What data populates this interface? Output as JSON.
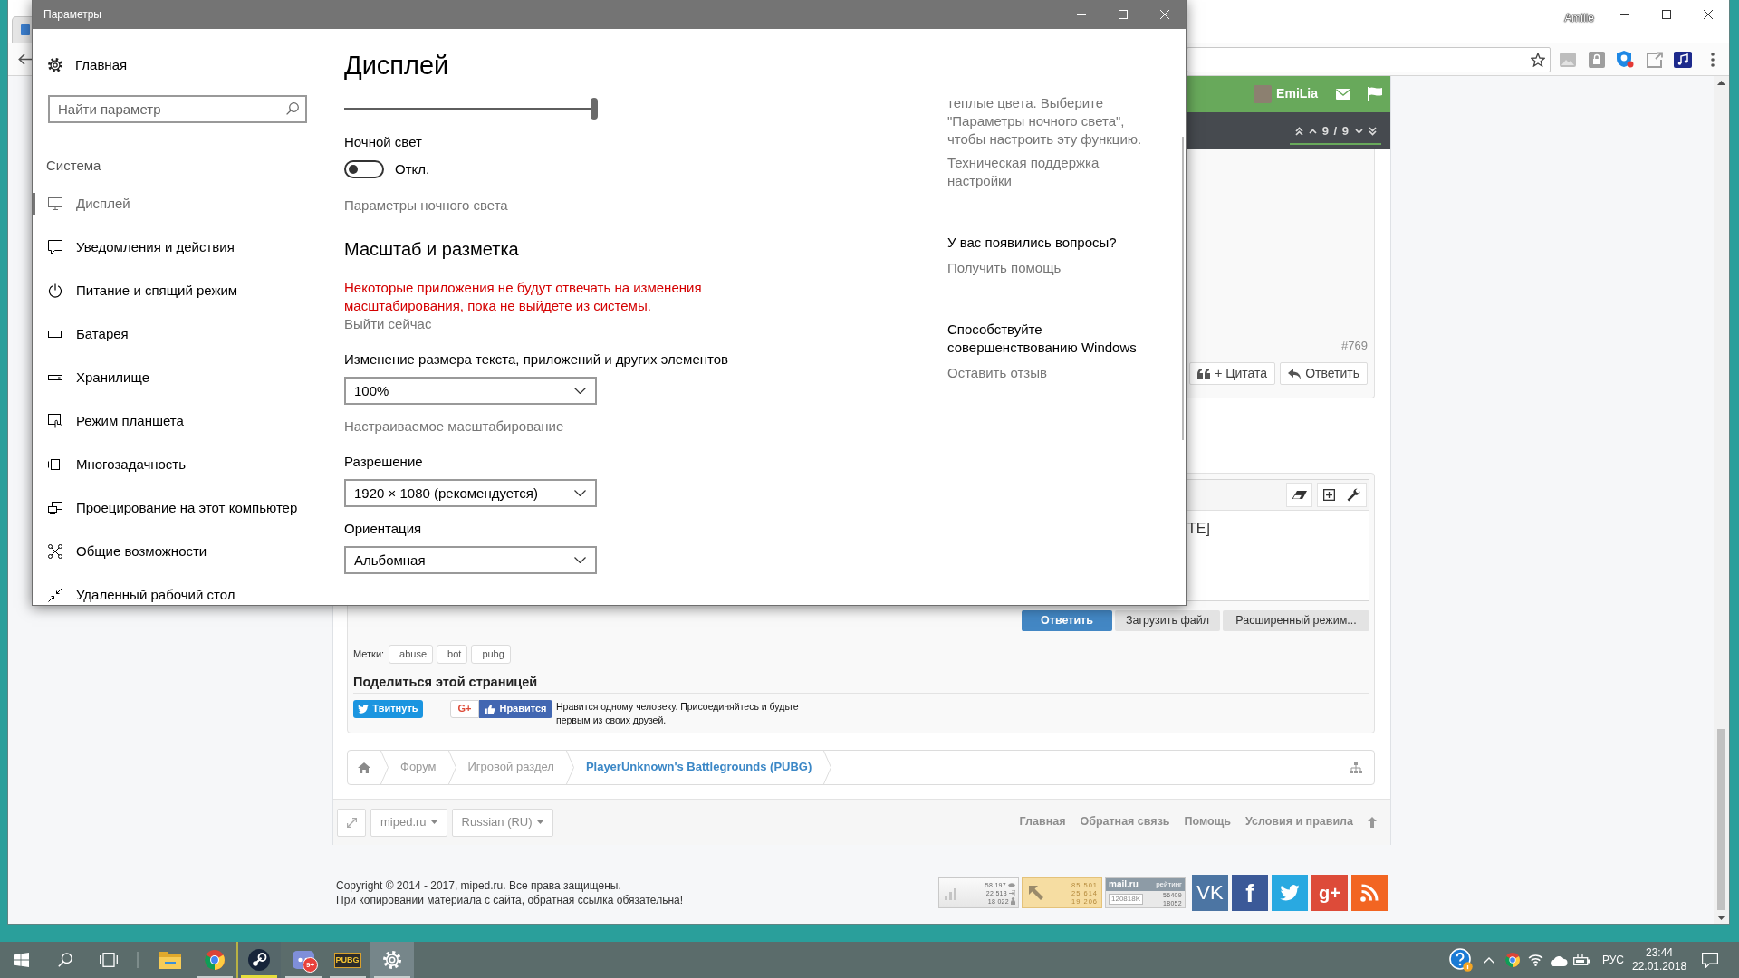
{
  "settings": {
    "title": "Параметры",
    "home": "Главная",
    "search": {
      "placeholder": "Найти параметр"
    },
    "section": "Система",
    "nav": [
      {
        "kind": "display",
        "label": "Дисплей",
        "selected": true
      },
      {
        "kind": "notifications",
        "label": "Уведомления и действия",
        "selected": false
      },
      {
        "kind": "power",
        "label": "Питание и спящий режим",
        "selected": false
      },
      {
        "kind": "battery",
        "label": "Батарея",
        "selected": false
      },
      {
        "kind": "storage",
        "label": "Хранилище",
        "selected": false
      },
      {
        "kind": "tablet",
        "label": "Режим планшета",
        "selected": false
      },
      {
        "kind": "multitasking",
        "label": "Многозадачность",
        "selected": false
      },
      {
        "kind": "projecting",
        "label": "Проецирование на этот компьютер",
        "selected": false
      },
      {
        "kind": "accessibility",
        "label": "Общие возможности",
        "selected": false
      },
      {
        "kind": "remote",
        "label": "Удаленный рабочий стол",
        "selected": false
      }
    ],
    "page_title": "Дисплей",
    "brightness": {
      "level": 1
    },
    "night_light": {
      "label": "Ночной свет",
      "on": false,
      "state": "Откл.",
      "link": "Параметры ночного света"
    },
    "scale": {
      "heading": "Масштаб и разметка",
      "warning": "Некоторые приложения не будут отвечать на изменения масштабирования, пока не выйдете из системы.",
      "action": "Выйти сейчас",
      "fields": [
        {
          "label": "Изменение размера текста, приложений и других элементов",
          "value": "100%",
          "link": "Настраиваемое масштабирование"
        },
        {
          "label": "Разрешение",
          "value": "1920 × 1080 (рекомендуется)"
        },
        {
          "label": "Ориентация",
          "value": "Альбомная"
        }
      ]
    },
    "aside": {
      "note": "теплые цвета. Выберите \"Параметры ночного света\", чтобы настроить эту функцию.",
      "note_link": "Техническая поддержка настройки",
      "sections": [
        {
          "heading": "У вас появились вопросы?",
          "link": "Получить помощь"
        },
        {
          "heading": "Способствуйте совершенствованию Windows",
          "link": "Оставить отзыв"
        }
      ]
    }
  },
  "browser": {
    "profile": "Amilie",
    "forum": {
      "user": "EmiLia",
      "pager": "9 / 9",
      "post": {
        "number": "#769",
        "actions": [
          {
            "kind": "quote",
            "label": "+ Цитата"
          },
          {
            "kind": "reply",
            "label": "Ответить"
          }
        ]
      },
      "editor": {
        "text": "TE]"
      },
      "buttons": [
        {
          "label": "Ответить",
          "primary": true
        },
        {
          "label": "Загрузить файл",
          "primary": false
        },
        {
          "label": "Расширенный режим...",
          "primary": false
        }
      ],
      "tags_label": "Метки:",
      "tags": [
        "abuse",
        "bot",
        "pubg"
      ],
      "share": {
        "title": "Поделиться этой страницей",
        "tweet": "Твитнуть",
        "plus": "G+",
        "like": "Нравится",
        "like_note": "Нравится одному человеку. Присоединяйтесь и будьте первым из своих друзей."
      },
      "breadcrumbs": [
        {
          "label": "Форум",
          "selected": false
        },
        {
          "label": "Игровой раздел",
          "selected": false
        },
        {
          "label": "PlayerUnknown's Battlegrounds (PUBG)",
          "selected": true
        }
      ],
      "footer_menus": [
        "miped.ru",
        "Russian (RU)"
      ],
      "footer_links": [
        "Главная",
        "Обратная связь",
        "Помощь",
        "Условия и правила"
      ],
      "copyright": [
        "Copyright © 2014 - 2017, miped.ru. Все права защищены.",
        "При копировании материала с сайта, обратная ссылка обязательна!"
      ],
      "counters": [
        {
          "kind": "stats",
          "values": [
            "58 197",
            "22 513",
            "18 022"
          ]
        },
        {
          "kind": "arrow",
          "values": [
            "85 501",
            "25 614",
            "19 206"
          ]
        },
        {
          "kind": "rating",
          "brand": "mail.ru",
          "caption": "рейтинг",
          "total": "120818K",
          "values": [
            "56409",
            "18052"
          ]
        }
      ],
      "social": [
        {
          "kind": "vk",
          "label": "VK"
        },
        {
          "kind": "fb",
          "label": "f"
        },
        {
          "kind": "bird"
        },
        {
          "kind": "gplus",
          "label": "g+"
        },
        {
          "kind": "rss"
        }
      ]
    }
  },
  "taskbar": {
    "apps": [
      {
        "kind": "folder",
        "running": false,
        "active": false,
        "flashing": false
      },
      {
        "kind": "browser",
        "running": true,
        "active": false,
        "flashing": false
      },
      {
        "kind": "steam",
        "running": true,
        "active": false,
        "flashing": true
      },
      {
        "kind": "chat",
        "badge": "9+",
        "running": true,
        "active": false,
        "flashing": false
      },
      {
        "kind": "game",
        "label": "PUBG",
        "running": true,
        "active": false,
        "flashing": false
      },
      {
        "kind": "settings",
        "running": true,
        "active": true,
        "flashing": false
      }
    ],
    "tray": {
      "language": "РУС",
      "time": "23:44",
      "date": "22.01.2018"
    }
  }
}
